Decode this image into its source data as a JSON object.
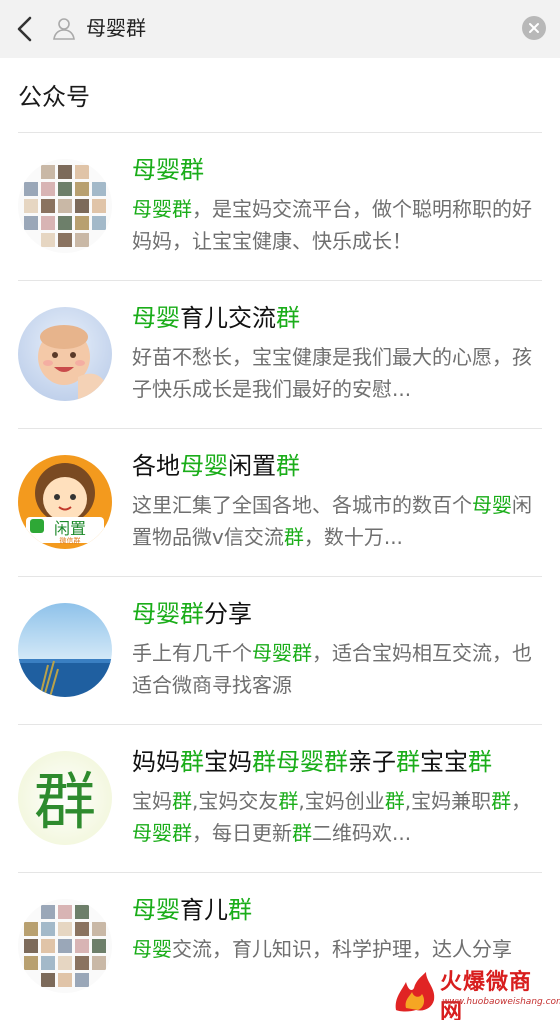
{
  "search": {
    "query": "母婴群"
  },
  "section": {
    "title": "公众号"
  },
  "results": [
    {
      "title": [
        {
          "t": "母婴群",
          "h": true
        }
      ],
      "desc": [
        {
          "t": "母婴群",
          "h": true
        },
        {
          "t": "，是宝妈交流平台，做个聪明称职的好妈妈，让宝宝健康、快乐成长！",
          "h": false
        }
      ]
    },
    {
      "title": [
        {
          "t": "母婴",
          "h": true
        },
        {
          "t": "育儿交流",
          "h": false
        },
        {
          "t": "群",
          "h": true
        }
      ],
      "desc": [
        {
          "t": "好苗不愁长，宝宝健康是我们最大的心愿，孩子快乐成长是我们最好的安慰...",
          "h": false
        }
      ]
    },
    {
      "title": [
        {
          "t": "各地",
          "h": false
        },
        {
          "t": "母婴",
          "h": true
        },
        {
          "t": "闲置",
          "h": false
        },
        {
          "t": "群",
          "h": true
        }
      ],
      "desc": [
        {
          "t": "这里汇集了全国各地、各城市的数百个",
          "h": false
        },
        {
          "t": "母婴",
          "h": true
        },
        {
          "t": "闲置物品微v信交流",
          "h": false
        },
        {
          "t": "群",
          "h": true
        },
        {
          "t": "，数十万...",
          "h": false
        }
      ]
    },
    {
      "title": [
        {
          "t": "母婴群",
          "h": true
        },
        {
          "t": "分享",
          "h": false
        }
      ],
      "desc": [
        {
          "t": "手上有几千个",
          "h": false
        },
        {
          "t": "母婴群",
          "h": true
        },
        {
          "t": "，适合宝妈相互交流，也适合微商寻找客源",
          "h": false
        }
      ]
    },
    {
      "title": [
        {
          "t": "妈妈",
          "h": false
        },
        {
          "t": "群",
          "h": true
        },
        {
          "t": "宝妈",
          "h": false
        },
        {
          "t": "群",
          "h": true
        },
        {
          "t": "母婴群",
          "h": true
        },
        {
          "t": "亲子",
          "h": false
        },
        {
          "t": "群",
          "h": true
        },
        {
          "t": "宝宝",
          "h": false
        },
        {
          "t": "群",
          "h": true
        }
      ],
      "desc": [
        {
          "t": "宝妈",
          "h": false
        },
        {
          "t": "群",
          "h": true
        },
        {
          "t": ",宝妈交友",
          "h": false
        },
        {
          "t": "群",
          "h": true
        },
        {
          "t": ",宝妈创业",
          "h": false
        },
        {
          "t": "群",
          "h": true
        },
        {
          "t": ",宝妈兼职",
          "h": false
        },
        {
          "t": "群",
          "h": true
        },
        {
          "t": "，",
          "h": false
        },
        {
          "t": "母婴群",
          "h": true
        },
        {
          "t": "，每日更新",
          "h": false
        },
        {
          "t": "群",
          "h": true
        },
        {
          "t": "二维码欢...",
          "h": false
        }
      ]
    },
    {
      "title": [
        {
          "t": "母婴",
          "h": true
        },
        {
          "t": "育儿",
          "h": false
        },
        {
          "t": "群",
          "h": true
        }
      ],
      "desc": [
        {
          "t": "母婴",
          "h": true
        },
        {
          "t": "交流，育儿知识，科学护理，达人分享",
          "h": false
        }
      ]
    }
  ],
  "avatars": {
    "logo3_top": "闲置",
    "logo3_bottom": "微信群",
    "logo5_char": "群"
  },
  "watermark": {
    "name": "火爆微商网",
    "url": "www.huobaoweishang.com"
  },
  "colors": {
    "highlight": "#1aad19",
    "search_bg": "#f2f2f2",
    "desc": "#6f6f6f",
    "separator": "#e5e5e5",
    "watermark": "#d81e1e"
  }
}
